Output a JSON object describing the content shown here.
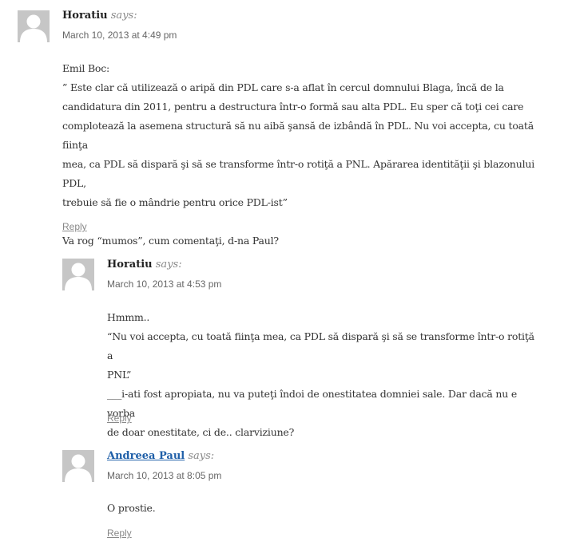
{
  "comments": [
    {
      "author": "Horatiu",
      "author_is_link": false,
      "says": "says:",
      "date": "March 10, 2013 at 4:49 pm",
      "paragraphs": [
        "Emil Boc:",
        "” Este clar că utilizează o aripă din PDL care s-a aflat în cercul domnului Blaga, încă de la",
        "candidatura din 2011, pentru a destructura într-o formă sau alta PDL. Eu sper că toţi cei care",
        "complotează la asemena structură să nu aibă şansă de izbândă în PDL. Nu voi accepta, cu toată fiinţa",
        "mea, ca PDL să dispară şi să se transforme într-o rotiţă a PNL. Apărarea identităţii şi blazonului PDL,",
        "trebuie să fie o mândrie pentru orice PDL-ist”",
        "",
        "Va rog “mumos”, cum comentaţi, d-na Paul?"
      ],
      "reply": "Reply"
    },
    {
      "author": "Horatiu",
      "author_is_link": false,
      "says": "says:",
      "date": "March 10, 2013 at 4:53 pm",
      "paragraphs": [
        "Hmmm..",
        "“Nu voi accepta, cu toată fiinţa mea, ca PDL să dispară şi să se transforme într-o rotiţă a",
        "PNL”",
        "___i-ati fost apropiata, nu va puteţi îndoi de onestitatea domniei sale. Dar dacă nu e vorba",
        "de doar onestitate, ci de.. clarviziune?"
      ],
      "reply": "Reply"
    },
    {
      "author": "Andreea Paul",
      "author_is_link": true,
      "says": "says:",
      "date": "March 10, 2013 at 8:05 pm",
      "paragraphs": [
        "O prostie."
      ],
      "reply": "Reply"
    }
  ]
}
